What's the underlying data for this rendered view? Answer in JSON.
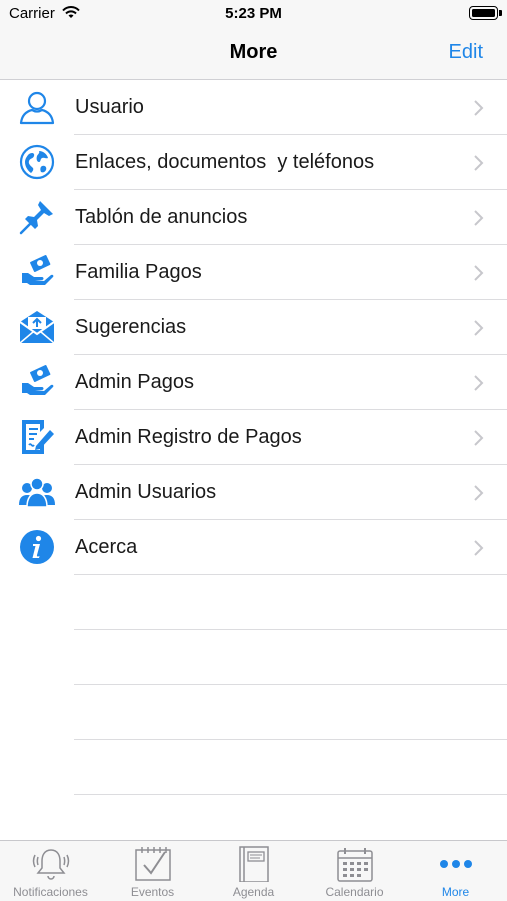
{
  "status_bar": {
    "carrier": "Carrier",
    "time": "5:23 PM"
  },
  "nav": {
    "title": "More",
    "edit_label": "Edit"
  },
  "accent_color": "#1f86e8",
  "menu": [
    {
      "label": "Usuario",
      "icon": "user-icon"
    },
    {
      "label": "Enlaces, documentos  y teléfonos",
      "icon": "globe-icon"
    },
    {
      "label": "Tablón de anuncios",
      "icon": "pushpin-icon"
    },
    {
      "label": "Familia Pagos",
      "icon": "payment-hand-icon"
    },
    {
      "label": "Sugerencias",
      "icon": "mail-envelope-icon"
    },
    {
      "label": "Admin Pagos",
      "icon": "payment-hand-icon"
    },
    {
      "label": "Admin Registro de Pagos",
      "icon": "document-edit-icon"
    },
    {
      "label": "Admin Usuarios",
      "icon": "users-group-icon"
    },
    {
      "label": "Acerca",
      "icon": "info-icon"
    }
  ],
  "tabs": [
    {
      "label": "Notificaciones",
      "icon": "bell-icon",
      "active": false
    },
    {
      "label": "Eventos",
      "icon": "checkbox-calendar-icon",
      "active": false
    },
    {
      "label": "Agenda",
      "icon": "notebook-icon",
      "active": false
    },
    {
      "label": "Calendario",
      "icon": "calendar-grid-icon",
      "active": false
    },
    {
      "label": "More",
      "icon": "more-dots-icon",
      "active": true
    }
  ]
}
